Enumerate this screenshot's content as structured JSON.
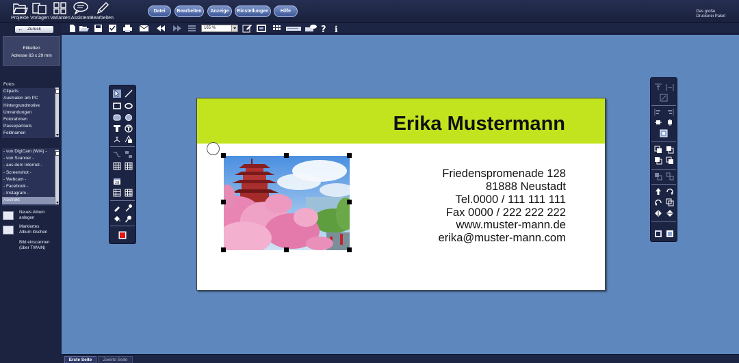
{
  "top_toolbar": {
    "items": [
      {
        "label": "Projekte",
        "icon": "folder-open-icon"
      },
      {
        "label": "Vorlagen",
        "icon": "templates-icon"
      },
      {
        "label": "Varianten",
        "icon": "grid-icon"
      },
      {
        "label": "Assistent",
        "icon": "speech-bubble-icon"
      },
      {
        "label": "Bearbeiten",
        "icon": "pen-icon"
      }
    ]
  },
  "main_menu": [
    "Datei",
    "Bearbeiten",
    "Anzeige",
    "Einstellungen",
    "Hilfe"
  ],
  "brand": {
    "line1": "Das große",
    "line2": "Druckerei  Paket"
  },
  "toolbar2": {
    "zoom_value": "165 %"
  },
  "left_panel": {
    "back_label": "Zurück",
    "format_title": "Etiketten",
    "format_size": "Adresse 63 x 29 mm",
    "categories_header": "Fotos",
    "categories": [
      "Cliparts",
      "Ausmalen am PC",
      "Hintergrundmotive",
      "Umrandungen",
      "Fotorahmen",
      "Passepartouts",
      "Feldnamen"
    ],
    "sources": [
      "- von DigiCam (WIA) -",
      "- von Scanner -",
      "- aus dem Internet -",
      "- Screenshot -",
      "- Webcam -",
      "- Facebook -",
      "- Instagram -"
    ],
    "album_selected": "Abstrakt",
    "actions": {
      "new_album_l1": "Neues Album",
      "new_album_l2": "anlegen",
      "delete_album_l1": "Markiertes",
      "delete_album_l2": "Album löschen",
      "scan_l1": "Bild einscannen",
      "scan_l2": "(über TWAIN)"
    }
  },
  "card": {
    "name": "Erika Mustermann",
    "band_color": "#c2e41f",
    "address_lines": [
      "Friedenspromenade 128",
      "81888 Neustadt",
      "Tel.0000 / 111 111 111",
      "Fax 0000 / 222 222 222",
      "www.muster-mann.de",
      "erika@muster-mann.com"
    ]
  },
  "page_tabs": [
    "Erste Seite",
    "Zweite Seite"
  ],
  "colors": {
    "canvas": "#5d87bd",
    "panel": "#1b2340",
    "accent_button": "#5a72b0"
  }
}
